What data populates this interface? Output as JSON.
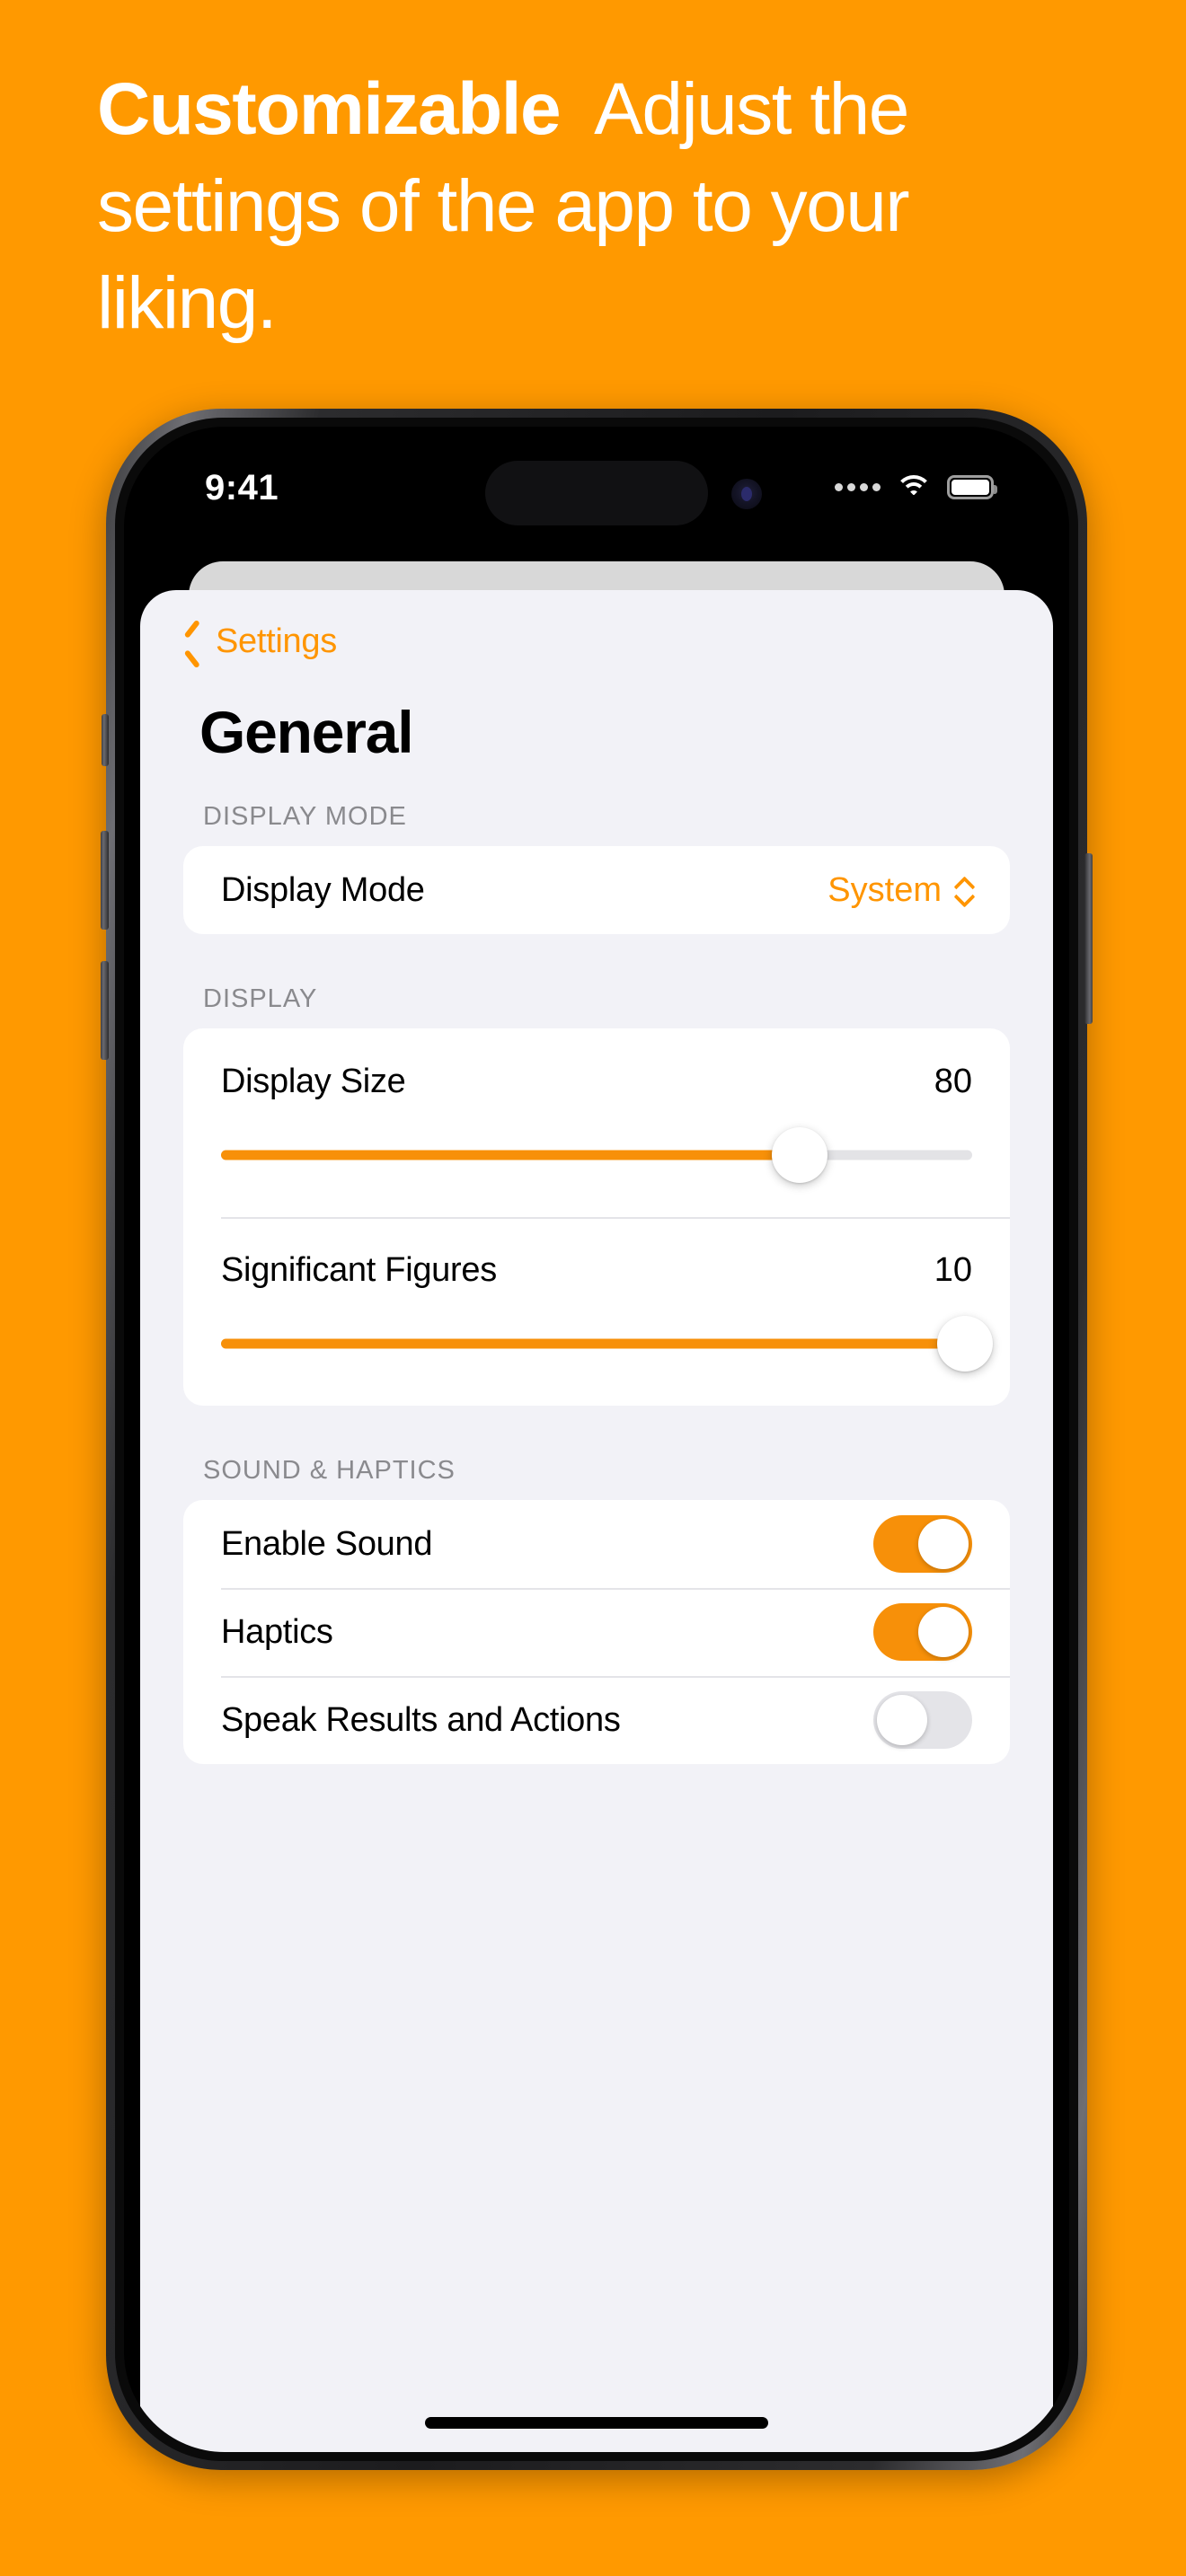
{
  "promo": {
    "headline_bold": "Customizable",
    "headline_rest": "Adjust the settings of the app to your liking.",
    "background_color": "#FF9900"
  },
  "accent_color": "#FF9500",
  "status_bar": {
    "time": "9:41",
    "cellular_icon": "cellular-dots-icon",
    "wifi_icon": "wifi-icon",
    "battery_icon": "battery-icon"
  },
  "navbar": {
    "back_label": "Settings",
    "back_icon": "chevron-left-icon",
    "title": "General"
  },
  "sections": [
    {
      "header": "DISPLAY MODE",
      "rows": [
        {
          "type": "picker",
          "label": "Display Mode",
          "value": "System",
          "icon": "chevron-up-down-icon"
        }
      ]
    },
    {
      "header": "DISPLAY",
      "rows": [
        {
          "type": "slider",
          "label": "Display Size",
          "value": "80",
          "percent": 77
        },
        {
          "type": "slider",
          "label": "Significant Figures",
          "value": "10",
          "percent": 99
        }
      ]
    },
    {
      "header": "SOUND & HAPTICS",
      "rows": [
        {
          "type": "toggle",
          "label": "Enable Sound",
          "state": "on"
        },
        {
          "type": "toggle",
          "label": "Haptics",
          "state": "on"
        },
        {
          "type": "toggle",
          "label": "Speak Results and Actions",
          "state": "off"
        }
      ]
    }
  ]
}
